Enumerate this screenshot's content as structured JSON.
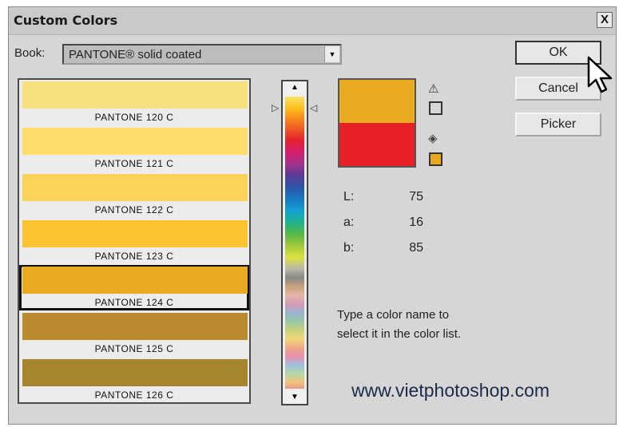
{
  "dialog": {
    "title": "Custom Colors",
    "close_label": "X"
  },
  "book": {
    "label": "Book:",
    "selected": "PANTONE® solid coated"
  },
  "swatches": [
    {
      "name": "PANTONE 120 C",
      "color": "#f8e07c"
    },
    {
      "name": "PANTONE 121 C",
      "color": "#fbdc6c"
    },
    {
      "name": "PANTONE 122 C",
      "color": "#fbd35a"
    },
    {
      "name": "PANTONE 123 C",
      "color": "#fec331"
    },
    {
      "name": "PANTONE 124 C",
      "color": "#e8ab22",
      "selected": true
    },
    {
      "name": "PANTONE 125 C",
      "color": "#b98b2e"
    },
    {
      "name": "PANTONE 126 C",
      "color": "#a7842e"
    }
  ],
  "preview": {
    "new_color": "#e8ab22",
    "original_color": "#e91f28"
  },
  "gamut": {
    "warning_icon": "warning-triangle-icon",
    "web_icon": "cube-icon",
    "web_swatch_color": "#e8a81e"
  },
  "lab": [
    {
      "label": "L:",
      "value": "75"
    },
    {
      "label": "a:",
      "value": "16"
    },
    {
      "label": "b:",
      "value": "85"
    }
  ],
  "buttons": {
    "ok": "OK",
    "cancel": "Cancel",
    "picker": "Picker"
  },
  "hint": {
    "line1": "Type a color name to",
    "line2": "select it in the color list."
  },
  "watermark": "www.vietphotoshop.com"
}
